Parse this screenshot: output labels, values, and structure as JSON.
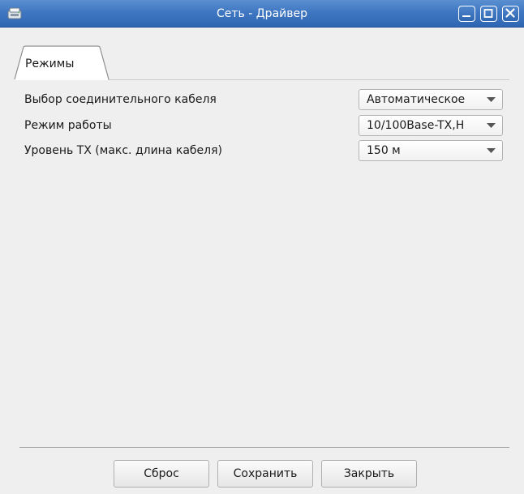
{
  "window": {
    "title": "Сеть - Драйвер",
    "icon": "network-card-icon",
    "controls": [
      "minimize-icon",
      "maximize-icon",
      "close-icon"
    ]
  },
  "tabs": [
    {
      "label": "Режимы",
      "active": true
    }
  ],
  "settings": [
    {
      "label": "Выбор соединительного кабеля",
      "value": "Автоматическое"
    },
    {
      "label": "Режим работы",
      "value": "10/100Base-TX,H"
    },
    {
      "label": "Уровень TX (макс. длина кабеля)",
      "value": "150 м"
    }
  ],
  "buttons": {
    "reset": "Сброс",
    "save": "Сохранить",
    "close": "Закрыть"
  },
  "colors": {
    "titlebar": "#3f77c2",
    "background": "#efefef"
  }
}
